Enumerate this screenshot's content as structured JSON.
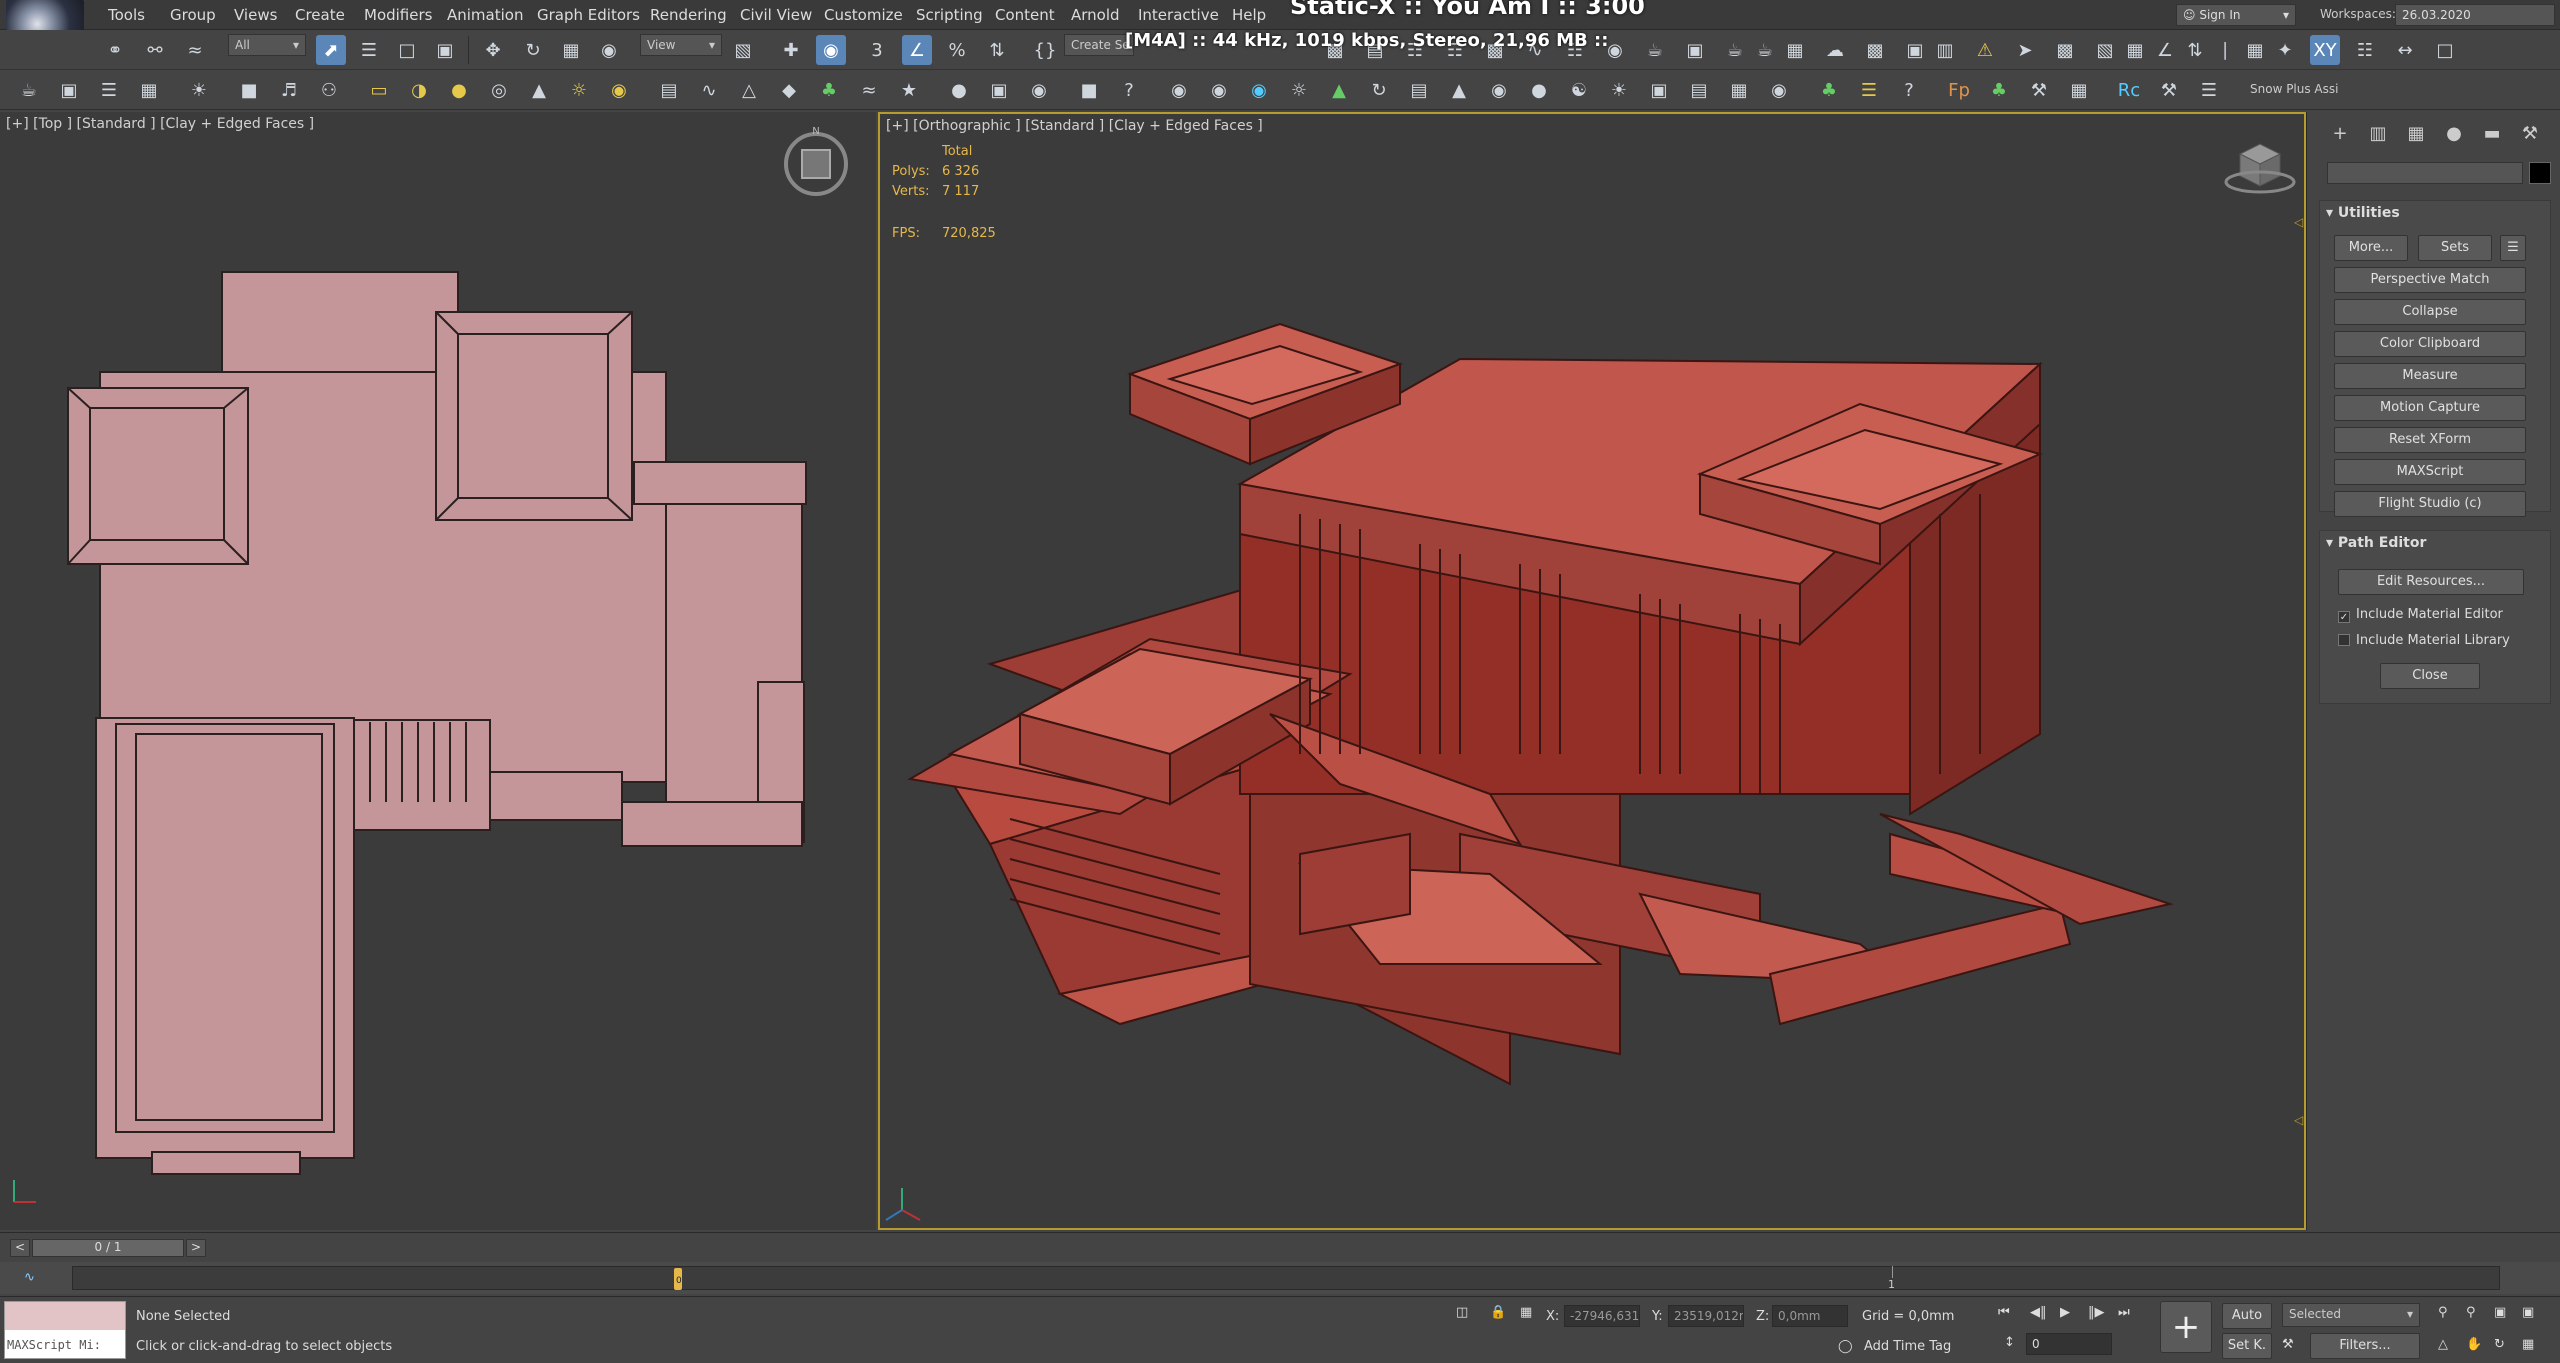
{
  "colors": {
    "accent": "#5a87b8",
    "viewport_border": "#b79b2e",
    "model": "#b5524a",
    "stat": "#e6b84a"
  },
  "overlay": {
    "title": "Static-X :: You Am I :: 3:00",
    "info": "[M4A] :: 44 kHz, 1019 kbps, Stereo, 21,96 MB ::"
  },
  "menu": [
    "Tools",
    "Group",
    "Views",
    "Create",
    "Modifiers",
    "Animation",
    "Graph Editors",
    "Rendering",
    "Civil View",
    "Customize",
    "Scripting",
    "Content",
    "Arnold",
    "Interactive",
    "Help"
  ],
  "account": {
    "sign_in": "Sign In",
    "workspaces_label": "Workspaces:",
    "workspace_value": "26.03.2020"
  },
  "toolbar": {
    "filter_all": "All",
    "view_dropdown": "View",
    "create_selection": "Create Se",
    "snow_plus": "Snow Plus Assi"
  },
  "viewport_left": {
    "label": "[+] [Top ] [Standard ] [Clay + Edged Faces ]"
  },
  "viewport_right": {
    "label": "[+] [Orthographic ] [Standard ] [Clay + Edged Faces ]",
    "stats": {
      "total_label": "Total",
      "polys_label": "Polys:",
      "polys_value": "6 326",
      "verts_label": "Verts:",
      "verts_value": "7 117",
      "fps_label": "FPS:",
      "fps_value": "720,825"
    }
  },
  "panel": {
    "utilities_title": "Utilities",
    "more_button": "More...",
    "sets_button": "Sets",
    "buttons": [
      "Perspective Match",
      "Collapse",
      "Color Clipboard",
      "Measure",
      "Motion Capture",
      "Reset XForm",
      "MAXScript",
      "Flight Studio (c)"
    ],
    "path_editor_title": "Path Editor",
    "edit_resources": "Edit Resources...",
    "include_material_editor": "Include Material Editor",
    "include_material_library": "Include Material Library",
    "close_button": "Close"
  },
  "timeline": {
    "frame_counter": "0 / 1",
    "prev": "<",
    "next": ">",
    "track_label": "1",
    "zero_marker": "0"
  },
  "status": {
    "maxscript": "MAXScript Mi:",
    "none_selected": "None Selected",
    "hint": "Click or click-and-drag to select objects",
    "x_label": "X:",
    "x_value": "-27946,631",
    "y_label": "Y:",
    "y_value": "23519,012m",
    "z_label": "Z:",
    "z_value": "0,0mm",
    "grid": "Grid = 0,0mm",
    "add_time_tag": "Add Time Tag",
    "auto": "Auto",
    "selected": "Selected",
    "set_key": "Set K.",
    "filters": "Filters...",
    "frame_field": "0"
  }
}
